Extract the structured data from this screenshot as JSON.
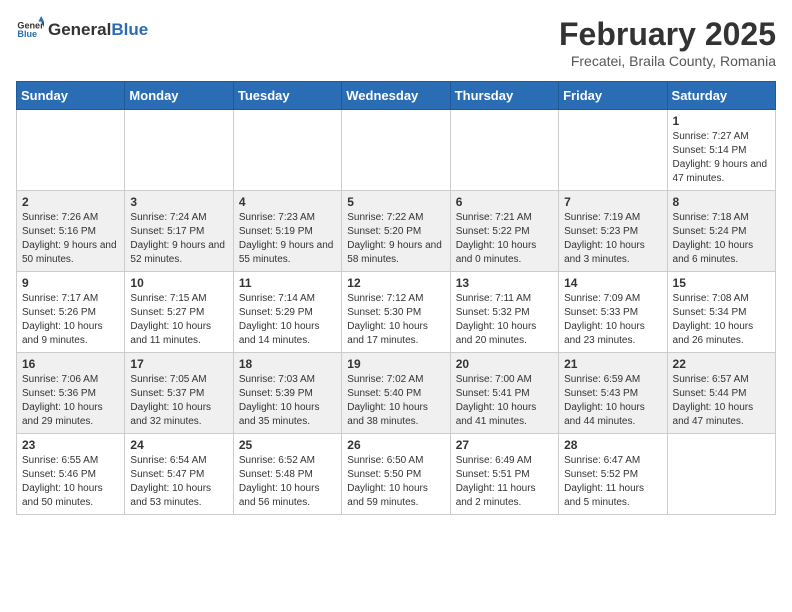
{
  "header": {
    "logo_general": "General",
    "logo_blue": "Blue",
    "month_year": "February 2025",
    "location": "Frecatei, Braila County, Romania"
  },
  "weekdays": [
    "Sunday",
    "Monday",
    "Tuesday",
    "Wednesday",
    "Thursday",
    "Friday",
    "Saturday"
  ],
  "weeks": [
    [
      {
        "day": "",
        "info": ""
      },
      {
        "day": "",
        "info": ""
      },
      {
        "day": "",
        "info": ""
      },
      {
        "day": "",
        "info": ""
      },
      {
        "day": "",
        "info": ""
      },
      {
        "day": "",
        "info": ""
      },
      {
        "day": "1",
        "info": "Sunrise: 7:27 AM\nSunset: 5:14 PM\nDaylight: 9 hours and 47 minutes."
      }
    ],
    [
      {
        "day": "2",
        "info": "Sunrise: 7:26 AM\nSunset: 5:16 PM\nDaylight: 9 hours and 50 minutes."
      },
      {
        "day": "3",
        "info": "Sunrise: 7:24 AM\nSunset: 5:17 PM\nDaylight: 9 hours and 52 minutes."
      },
      {
        "day": "4",
        "info": "Sunrise: 7:23 AM\nSunset: 5:19 PM\nDaylight: 9 hours and 55 minutes."
      },
      {
        "day": "5",
        "info": "Sunrise: 7:22 AM\nSunset: 5:20 PM\nDaylight: 9 hours and 58 minutes."
      },
      {
        "day": "6",
        "info": "Sunrise: 7:21 AM\nSunset: 5:22 PM\nDaylight: 10 hours and 0 minutes."
      },
      {
        "day": "7",
        "info": "Sunrise: 7:19 AM\nSunset: 5:23 PM\nDaylight: 10 hours and 3 minutes."
      },
      {
        "day": "8",
        "info": "Sunrise: 7:18 AM\nSunset: 5:24 PM\nDaylight: 10 hours and 6 minutes."
      }
    ],
    [
      {
        "day": "9",
        "info": "Sunrise: 7:17 AM\nSunset: 5:26 PM\nDaylight: 10 hours and 9 minutes."
      },
      {
        "day": "10",
        "info": "Sunrise: 7:15 AM\nSunset: 5:27 PM\nDaylight: 10 hours and 11 minutes."
      },
      {
        "day": "11",
        "info": "Sunrise: 7:14 AM\nSunset: 5:29 PM\nDaylight: 10 hours and 14 minutes."
      },
      {
        "day": "12",
        "info": "Sunrise: 7:12 AM\nSunset: 5:30 PM\nDaylight: 10 hours and 17 minutes."
      },
      {
        "day": "13",
        "info": "Sunrise: 7:11 AM\nSunset: 5:32 PM\nDaylight: 10 hours and 20 minutes."
      },
      {
        "day": "14",
        "info": "Sunrise: 7:09 AM\nSunset: 5:33 PM\nDaylight: 10 hours and 23 minutes."
      },
      {
        "day": "15",
        "info": "Sunrise: 7:08 AM\nSunset: 5:34 PM\nDaylight: 10 hours and 26 minutes."
      }
    ],
    [
      {
        "day": "16",
        "info": "Sunrise: 7:06 AM\nSunset: 5:36 PM\nDaylight: 10 hours and 29 minutes."
      },
      {
        "day": "17",
        "info": "Sunrise: 7:05 AM\nSunset: 5:37 PM\nDaylight: 10 hours and 32 minutes."
      },
      {
        "day": "18",
        "info": "Sunrise: 7:03 AM\nSunset: 5:39 PM\nDaylight: 10 hours and 35 minutes."
      },
      {
        "day": "19",
        "info": "Sunrise: 7:02 AM\nSunset: 5:40 PM\nDaylight: 10 hours and 38 minutes."
      },
      {
        "day": "20",
        "info": "Sunrise: 7:00 AM\nSunset: 5:41 PM\nDaylight: 10 hours and 41 minutes."
      },
      {
        "day": "21",
        "info": "Sunrise: 6:59 AM\nSunset: 5:43 PM\nDaylight: 10 hours and 44 minutes."
      },
      {
        "day": "22",
        "info": "Sunrise: 6:57 AM\nSunset: 5:44 PM\nDaylight: 10 hours and 47 minutes."
      }
    ],
    [
      {
        "day": "23",
        "info": "Sunrise: 6:55 AM\nSunset: 5:46 PM\nDaylight: 10 hours and 50 minutes."
      },
      {
        "day": "24",
        "info": "Sunrise: 6:54 AM\nSunset: 5:47 PM\nDaylight: 10 hours and 53 minutes."
      },
      {
        "day": "25",
        "info": "Sunrise: 6:52 AM\nSunset: 5:48 PM\nDaylight: 10 hours and 56 minutes."
      },
      {
        "day": "26",
        "info": "Sunrise: 6:50 AM\nSunset: 5:50 PM\nDaylight: 10 hours and 59 minutes."
      },
      {
        "day": "27",
        "info": "Sunrise: 6:49 AM\nSunset: 5:51 PM\nDaylight: 11 hours and 2 minutes."
      },
      {
        "day": "28",
        "info": "Sunrise: 6:47 AM\nSunset: 5:52 PM\nDaylight: 11 hours and 5 minutes."
      },
      {
        "day": "",
        "info": ""
      }
    ]
  ]
}
